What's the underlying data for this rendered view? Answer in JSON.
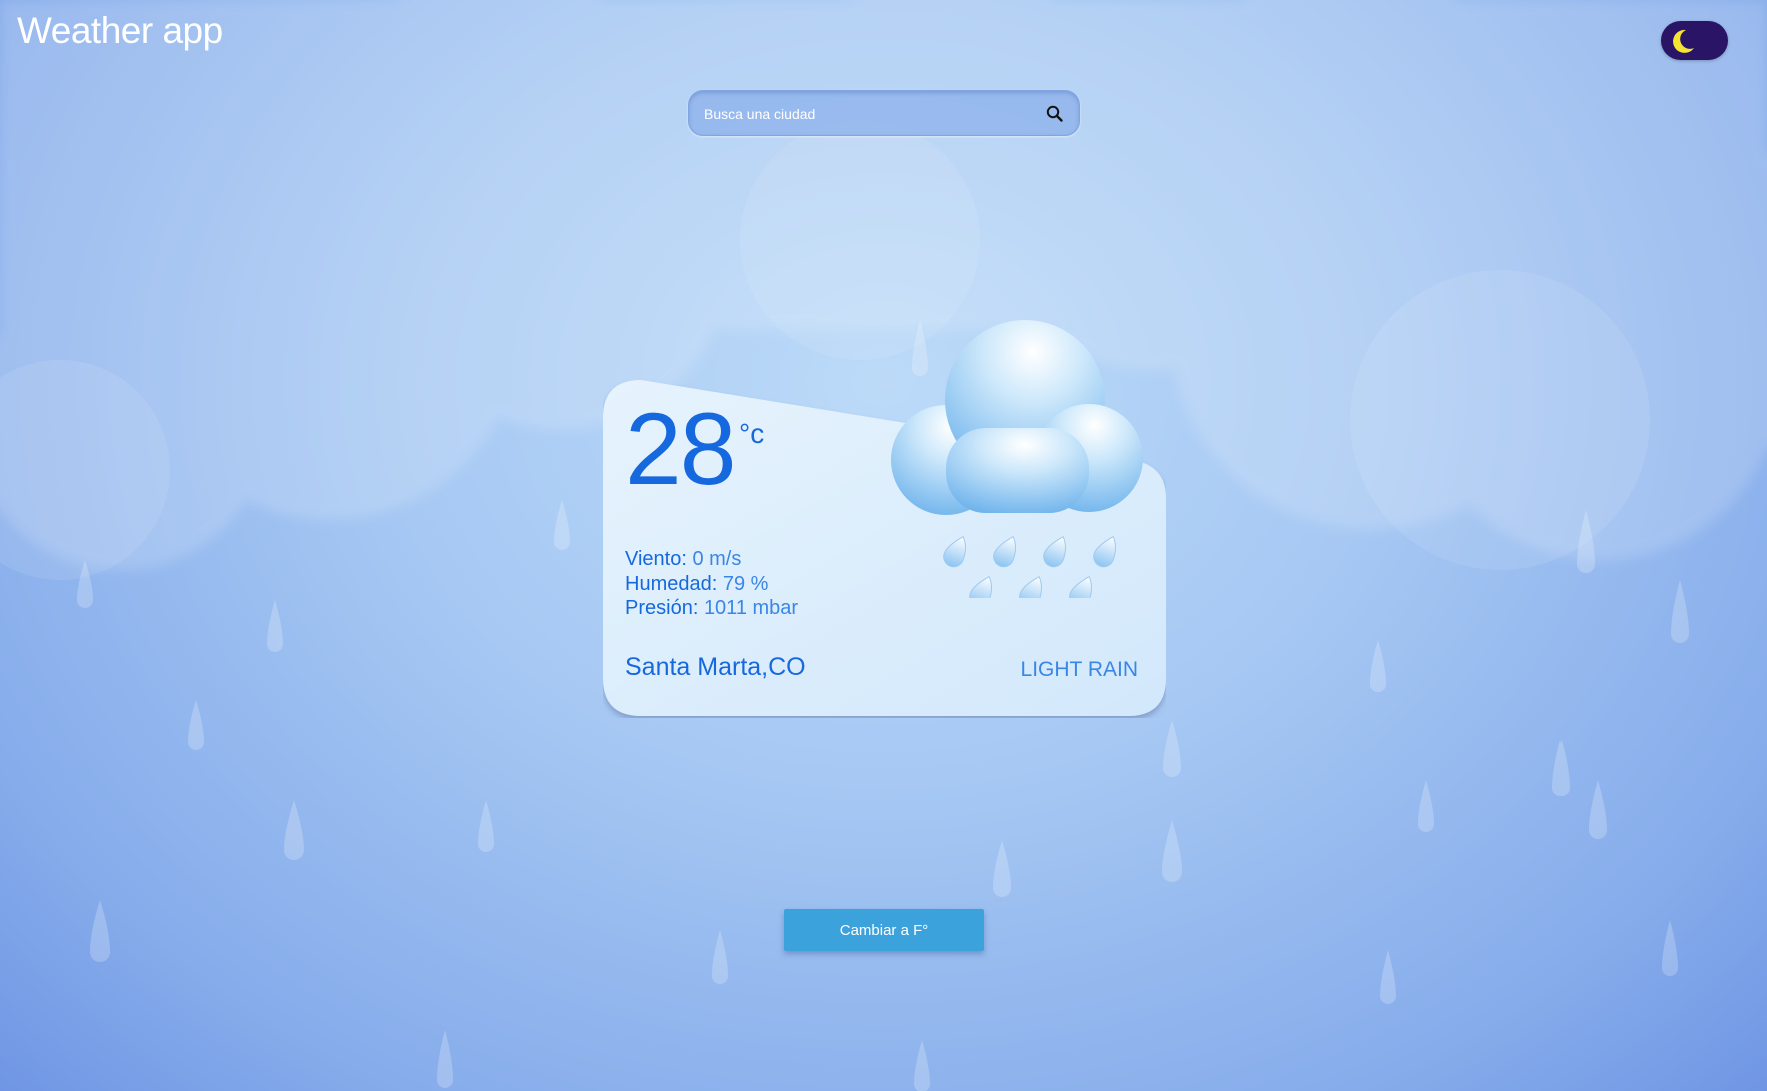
{
  "header": {
    "app_title": "Weather app",
    "theme_toggle_icon": "moon-icon"
  },
  "search": {
    "placeholder": "Busca una ciudad",
    "value": "",
    "icon": "search-icon"
  },
  "weather": {
    "temperature": "28",
    "unit": "°c",
    "wind_label": "Viento:",
    "wind_value": "0 m/s",
    "humidity_label": "Humedad:",
    "humidity_value": "79 %",
    "pressure_label": "Presión:",
    "pressure_value": "1011 mbar",
    "city": "Santa Marta,CO",
    "condition": "LIGHT RAIN",
    "icon": "rain-cloud-icon"
  },
  "actions": {
    "toggle_unit_label": "Cambiar a F°"
  },
  "colors": {
    "accent": "#1668de",
    "button": "#3ca2dc",
    "toggle": "#2a1466",
    "moon": "#f5e431"
  }
}
